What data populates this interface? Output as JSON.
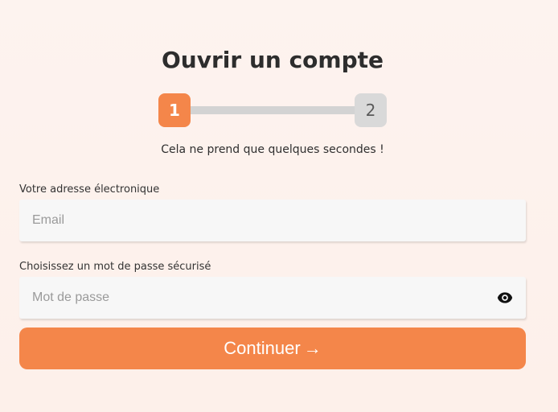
{
  "page": {
    "title": "Ouvrir un compte",
    "subtitle": "Cela ne prend que quelques secondes !"
  },
  "stepper": {
    "steps": [
      {
        "label": "1",
        "state": "active"
      },
      {
        "label": "2",
        "state": "inactive"
      }
    ],
    "current_step": 1,
    "colors": {
      "active": "#f4864a",
      "inactive": "#d9d9d9"
    }
  },
  "form": {
    "email": {
      "label": "Votre adresse électronique",
      "placeholder": "Email",
      "value": ""
    },
    "password": {
      "label": "Choisissez un mot de passe sécurisé",
      "placeholder": "Mot de passe",
      "value": "",
      "toggle_icon": "eye-icon"
    },
    "submit": {
      "label": "Continuer",
      "icon": "arrow-right-icon",
      "arrow_glyph": "→"
    }
  },
  "colors": {
    "accent": "#f4864a",
    "background": "#fdf3ef"
  }
}
